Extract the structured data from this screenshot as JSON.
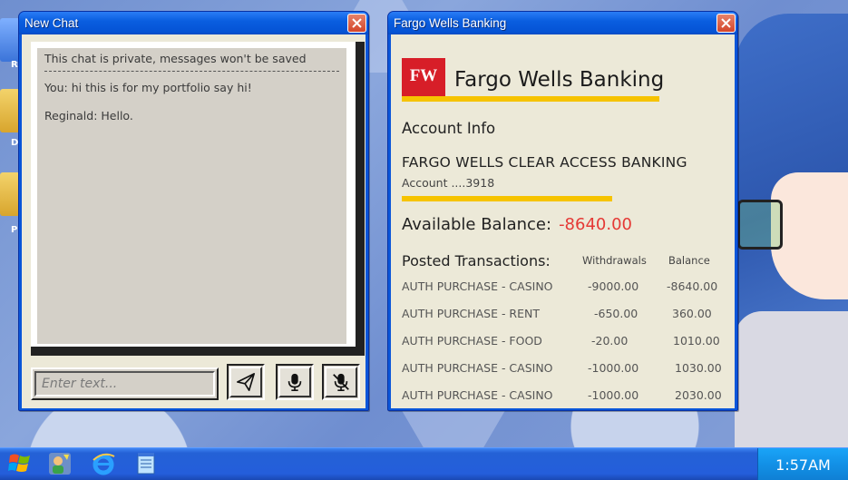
{
  "desktop": {
    "icons": [
      {
        "label": "R",
        "icon": "folder-icon"
      },
      {
        "label": "D",
        "icon": "folder-icon"
      },
      {
        "label": "P",
        "icon": "folder-icon"
      }
    ]
  },
  "chat": {
    "title": "New Chat",
    "notice": "This chat is private, messages won't be saved",
    "messages": [
      {
        "text": "You: hi this is for my portfolio say hi!"
      },
      {
        "text": "Reginald: Hello."
      }
    ],
    "input_placeholder": "Enter text...",
    "buttons": [
      "send-icon",
      "microphone-icon",
      "microphone-mute-icon"
    ]
  },
  "bank": {
    "title": "Fargo Wells Banking",
    "logo_text": "FW",
    "name": "Fargo Wells Banking",
    "account_info_label": "Account Info",
    "account_type": "FARGO WELLS CLEAR ACCESS BANKING",
    "account_number": "Account ....3918",
    "balance_label": "Available Balance:",
    "balance_value": "-8640.00",
    "posted_label": "Posted Transactions:",
    "columns": {
      "withdrawals": "Withdrawals",
      "balance": "Balance"
    },
    "transactions": [
      {
        "desc": "AUTH PURCHASE - CASINO",
        "withdrawal": "-9000.00",
        "balance": "-8640.00"
      },
      {
        "desc": "AUTH PURCHASE - RENT",
        "withdrawal": "-650.00",
        "balance": "360.00"
      },
      {
        "desc": "AUTH PURCHASE - FOOD",
        "withdrawal": "-20.00",
        "balance": "1010.00"
      },
      {
        "desc": "AUTH PURCHASE - CASINO",
        "withdrawal": "-1000.00",
        "balance": "1030.00"
      },
      {
        "desc": "AUTH PURCHASE - CASINO",
        "withdrawal": "-1000.00",
        "balance": "2030.00"
      }
    ],
    "colors": {
      "accent_red": "#d71e28",
      "gold": "#f6c300",
      "negative": "#e53935"
    }
  },
  "taskbar": {
    "icons": [
      "start-logo-icon",
      "users-icon",
      "internet-explorer-icon",
      "notepad-icon"
    ],
    "clock": "1:57AM"
  }
}
